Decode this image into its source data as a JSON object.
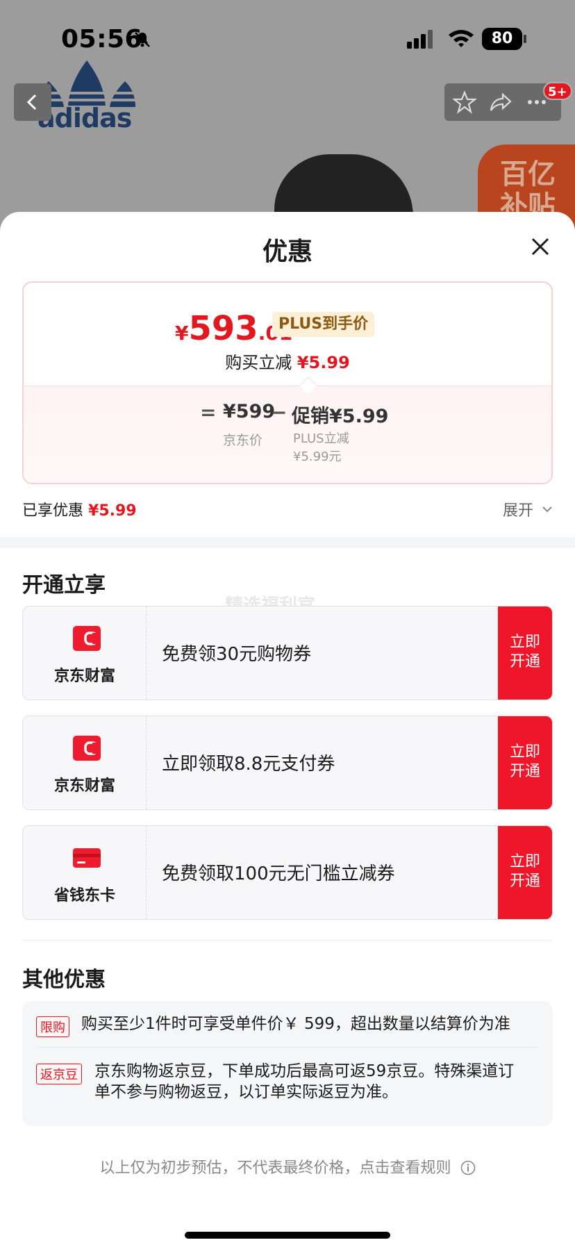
{
  "status_bar": {
    "time": "05:56",
    "battery": "80"
  },
  "background": {
    "brand_text": "adidas",
    "notification_badge": "5+",
    "subsidy_tag": "百亿补贴"
  },
  "sheet": {
    "title": "优惠"
  },
  "price_card": {
    "currency": "¥",
    "price_int": "593",
    "price_dec": ".01",
    "plus_badge": "PLUS到手价",
    "reduce_label": "购买立减",
    "reduce_value": "¥5.99",
    "equals": "=",
    "jd_price": "¥599",
    "jd_label": "京东价",
    "minus": "−",
    "promo_price": "促销¥5.99",
    "promo_label": "PLUS立减 ¥5.99元"
  },
  "enjoyed": {
    "label": "已享优惠",
    "value": "¥5.99",
    "expand_label": "展开"
  },
  "open_section": {
    "title": "开通立享",
    "watermark": "精选福利官",
    "offers": [
      {
        "brand": "京东财富",
        "desc": "免费领30元购物券",
        "cta_line1": "立即",
        "cta_line2": "开通",
        "icon": "jd-wealth-icon"
      },
      {
        "brand": "京东财富",
        "desc": "立即领取8.8元支付券",
        "cta_line1": "立即",
        "cta_line2": "开通",
        "icon": "jd-wealth-icon"
      },
      {
        "brand": "省钱东卡",
        "desc": "免费领取100元无门槛立减券",
        "cta_line1": "立即",
        "cta_line2": "开通",
        "icon": "card-icon"
      }
    ]
  },
  "other_section": {
    "title": "其他优惠",
    "items": [
      {
        "tag": "限购",
        "text": "购买至少1件时可享受单件价￥ 599，超出数量以结算价为准"
      },
      {
        "tag": "返京豆",
        "text_line1": "京东购物返京豆，下单成功后最高可返59京豆。特殊渠道订",
        "text_line2": "单不参与购物返豆，以订单实际返豆为准。"
      }
    ]
  },
  "footnote": "以上仅为初步预估，不代表最终价格，点击查看规则",
  "colors": {
    "accent_red": "#e4161f",
    "cta_red": "#f0162a",
    "plus_gold": "#8a5a12"
  }
}
